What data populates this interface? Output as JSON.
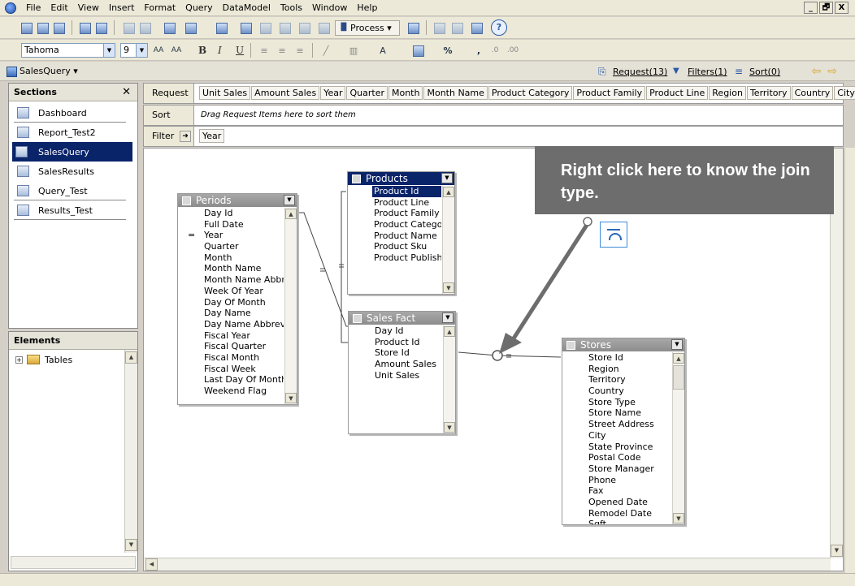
{
  "menu": {
    "items": [
      "File",
      "Edit",
      "View",
      "Insert",
      "Format",
      "Query",
      "DataModel",
      "Tools",
      "Window",
      "Help"
    ],
    "window_controls": [
      "_",
      "🗗",
      "X"
    ]
  },
  "toolbar": {
    "process_label": "Process",
    "font_name": "Tahoma",
    "font_size": "9",
    "bold": "B",
    "italic": "I",
    "underline": "U",
    "percent": "%"
  },
  "querybar": {
    "query_name": "SalesQuery ▾",
    "request_link": "Request(13)",
    "filters_link": "Filters(1)",
    "sort_link": "Sort(0)"
  },
  "sections": {
    "title": "Sections",
    "items": [
      "Dashboard",
      "Report_Test2",
      "SalesQuery",
      "SalesResults",
      "Query_Test",
      "Results_Test"
    ],
    "selected": "SalesQuery"
  },
  "elements": {
    "title": "Elements",
    "tree_root": "Tables"
  },
  "request": {
    "label": "Request",
    "items": [
      "Unit Sales",
      "Amount Sales",
      "Year",
      "Quarter",
      "Month",
      "Month Name",
      "Product Category",
      "Product Family",
      "Product Line",
      "Region",
      "Territory",
      "Country",
      "City"
    ]
  },
  "sort": {
    "label": "Sort",
    "hint": "Drag Request Items here to sort them"
  },
  "filter": {
    "label": "Filter",
    "items": [
      "Year"
    ]
  },
  "tables": {
    "periods": {
      "title": "Periods",
      "fields": [
        "Day Id",
        "Full Date",
        "Year",
        "Quarter",
        "Month",
        "Month Name",
        "Month Name Abbr",
        "Week Of Year",
        "Day Of Month",
        "Day Name",
        "Day Name Abbrevi",
        "Fiscal Year",
        "Fiscal Quarter",
        "Fiscal Month",
        "Fiscal Week",
        "Last Day Of Month",
        "Weekend Flag"
      ],
      "join_marker": "="
    },
    "products": {
      "title": "Products",
      "fields": [
        "Product Id",
        "Product Line",
        "Product Family",
        "Product Catego",
        "Product Name",
        "Product Sku",
        "Product Publish"
      ]
    },
    "sales_fact": {
      "title": "Sales Fact",
      "fields": [
        "Day Id",
        "Product Id",
        "Store Id",
        "Amount Sales",
        "Unit Sales"
      ]
    },
    "stores": {
      "title": "Stores",
      "fields": [
        "Store Id",
        "Region",
        "Territory",
        "Country",
        "Store Type",
        "Store Name",
        "Street Address",
        "City",
        "State Province",
        "Postal Code",
        "Store Manager",
        "Phone",
        "Fax",
        "Opened Date",
        "Remodel Date",
        "Sqft"
      ]
    }
  },
  "joins": {
    "marker": "="
  },
  "callout": {
    "text": "Right click here to know the join type."
  },
  "colors": {
    "selection": "#0a246a",
    "callout_bg": "#6d6d6d",
    "arrow": "#6d6d6d"
  }
}
